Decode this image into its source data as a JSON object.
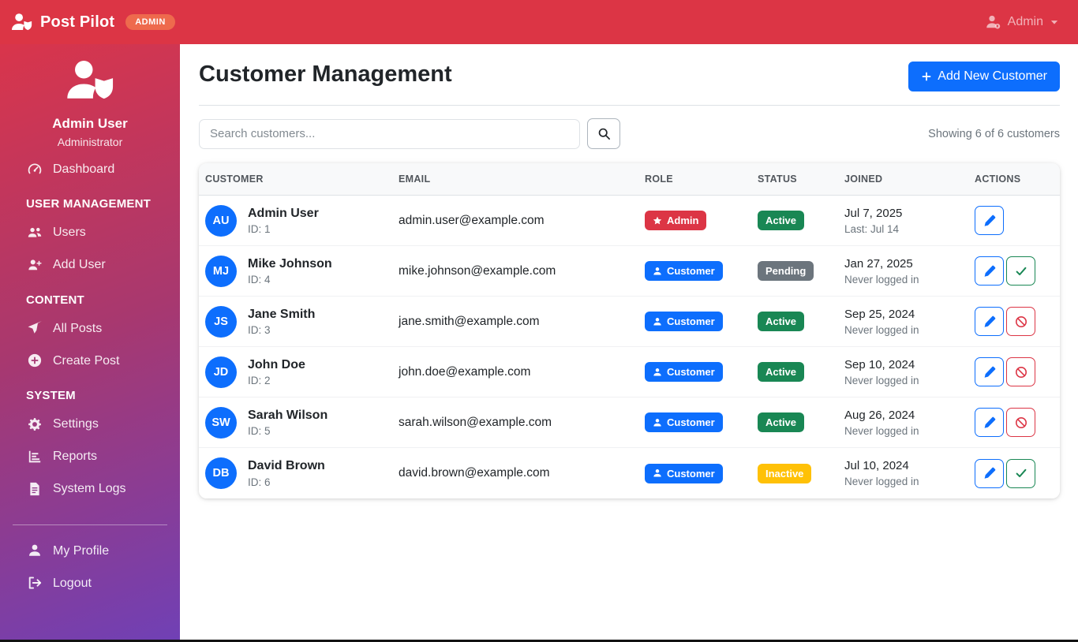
{
  "navbar": {
    "brand": "Post Pilot",
    "badge": "ADMIN",
    "brand_icon": "person-shield",
    "user_menu": {
      "label": "Admin",
      "icon": "person-badge",
      "caret_icon": "caret-down"
    }
  },
  "sidebar": {
    "profile": {
      "icon": "person-shield",
      "name": "Admin User",
      "role": "Administrator"
    },
    "sections": [
      {
        "header": "",
        "items": [
          {
            "icon": "speedometer",
            "label": "Dashboard"
          }
        ]
      },
      {
        "header": "USER MANAGEMENT",
        "items": [
          {
            "icon": "people",
            "label": "Users"
          },
          {
            "icon": "person-plus",
            "label": "Add User"
          }
        ]
      },
      {
        "header": "CONTENT",
        "items": [
          {
            "icon": "send",
            "label": "All Posts"
          },
          {
            "icon": "plus-circle",
            "label": "Create Post"
          }
        ]
      },
      {
        "header": "SYSTEM",
        "items": [
          {
            "icon": "gear",
            "label": "Settings"
          },
          {
            "icon": "bar-chart",
            "label": "Reports"
          },
          {
            "icon": "file-text",
            "label": "System Logs"
          }
        ]
      }
    ],
    "footer_items": [
      {
        "icon": "person",
        "label": "My Profile"
      },
      {
        "icon": "box-arrow-right",
        "label": "Logout"
      }
    ]
  },
  "main": {
    "title": "Customer Management",
    "add_button": {
      "icon": "plus",
      "label": "Add New Customer"
    },
    "search": {
      "placeholder": "Search customers...",
      "value": "",
      "button_icon": "search"
    },
    "count_text": "Showing 6 of 6 customers",
    "table": {
      "columns": [
        "CUSTOMER",
        "EMAIL",
        "ROLE",
        "STATUS",
        "JOINED",
        "ACTIONS"
      ],
      "rows": [
        {
          "initials": "AU",
          "name": "Admin User",
          "id_label": "ID: 1",
          "email": "admin.user@example.com",
          "role": "Admin",
          "status": "Active",
          "joined": "Jul 7, 2025",
          "joined_sub": "Last: Jul 14",
          "actions": [
            "edit"
          ]
        },
        {
          "initials": "MJ",
          "name": "Mike Johnson",
          "id_label": "ID: 4",
          "email": "mike.johnson@example.com",
          "role": "Customer",
          "status": "Pending",
          "joined": "Jan 27, 2025",
          "joined_sub": "Never logged in",
          "actions": [
            "edit",
            "activate"
          ]
        },
        {
          "initials": "JS",
          "name": "Jane Smith",
          "id_label": "ID: 3",
          "email": "jane.smith@example.com",
          "role": "Customer",
          "status": "Active",
          "joined": "Sep 25, 2024",
          "joined_sub": "Never logged in",
          "actions": [
            "edit",
            "deactivate"
          ]
        },
        {
          "initials": "JD",
          "name": "John Doe",
          "id_label": "ID: 2",
          "email": "john.doe@example.com",
          "role": "Customer",
          "status": "Active",
          "joined": "Sep 10, 2024",
          "joined_sub": "Never logged in",
          "actions": [
            "edit",
            "deactivate"
          ]
        },
        {
          "initials": "SW",
          "name": "Sarah Wilson",
          "id_label": "ID: 5",
          "email": "sarah.wilson@example.com",
          "role": "Customer",
          "status": "Active",
          "joined": "Aug 26, 2024",
          "joined_sub": "Never logged in",
          "actions": [
            "edit",
            "deactivate"
          ]
        },
        {
          "initials": "DB",
          "name": "David Brown",
          "id_label": "ID: 6",
          "email": "david.brown@example.com",
          "role": "Customer",
          "status": "Inactive",
          "joined": "Jul 10, 2024",
          "joined_sub": "Never logged in",
          "actions": [
            "edit",
            "activate"
          ]
        }
      ]
    }
  },
  "colors": {
    "navbar_red": "#dc3545",
    "sidebar_purple": "#7040b5",
    "admin_pill": "#ee6a4d",
    "primary_blue": "#0d6efd",
    "success_green": "#198754",
    "warning_yellow": "#ffc107",
    "muted_gray": "#6c757d"
  }
}
